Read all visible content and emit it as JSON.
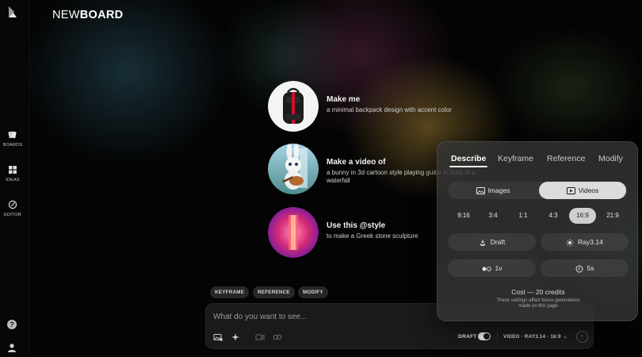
{
  "sidebar": {
    "items": [
      {
        "label": "BOARDS",
        "icon": "boards-icon"
      },
      {
        "label": "IDEAS",
        "icon": "ideas-icon"
      },
      {
        "label": "EDITOR",
        "icon": "editor-icon"
      }
    ],
    "help_label": "?"
  },
  "board": {
    "title_light": "NEW",
    "title_bold": "BOARD"
  },
  "suggestions": [
    {
      "title": "Make me",
      "desc": "a minimal backpack design with accent color"
    },
    {
      "title": "Make a video of",
      "desc": "a bunny in 3d cartoon style playing guitar in front of a waterfall"
    },
    {
      "title": "Use this @style",
      "desc": "to make a Greek stone sculpture"
    }
  ],
  "chips": [
    "KEYFRAME",
    "REFERENCE",
    "MODIFY"
  ],
  "prompt": {
    "placeholder": "What do you want to see...",
    "draft_label": "DRAFT",
    "model_label": "VIDEO · RAY3.14 · 16:9",
    "send_icon": "arrow-up-icon"
  },
  "panel": {
    "tabs": [
      "Describe",
      "Keyframe",
      "Reference",
      "Modify"
    ],
    "active_tab": "Describe",
    "media": {
      "images": "Images",
      "videos": "Videos",
      "selected": "Videos"
    },
    "ratios": [
      "9:16",
      "3:4",
      "1:1",
      "4:3",
      "16:9",
      "21:9"
    ],
    "selected_ratio": "16:9",
    "quality": "Draft",
    "model": "Ray3.14",
    "variations": "1v",
    "duration": "5s",
    "cost": "Cost — 20 credits",
    "note": "These settings affect future generations made on this page"
  },
  "colors": {
    "accent": "#dcdcdc",
    "panel_bg": "#343434",
    "backpack_stripe": "#c8102e"
  }
}
